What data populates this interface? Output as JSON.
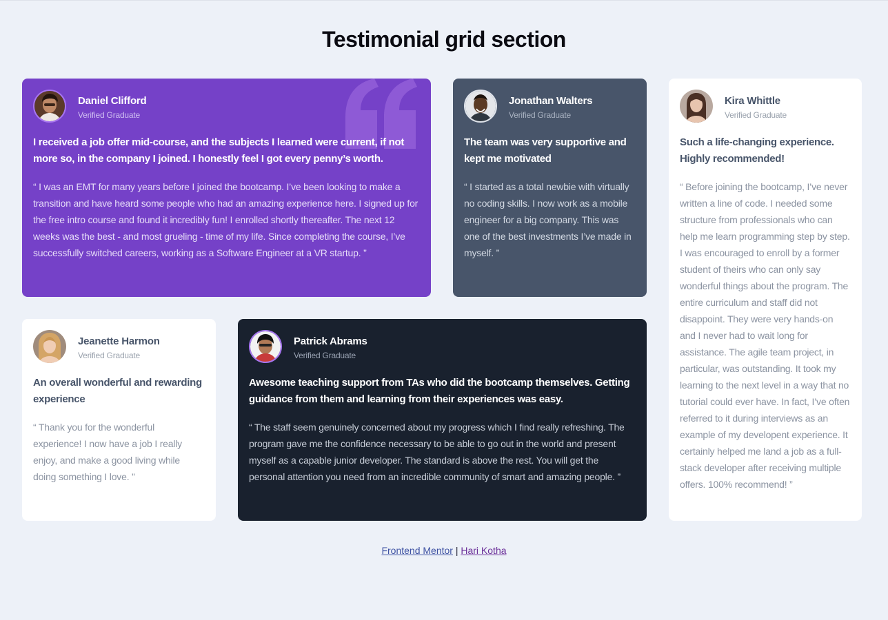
{
  "title": "Testimonial grid section",
  "cards": [
    {
      "name": "Daniel Clifford",
      "role": "Verified Graduate",
      "headline": "I received a job offer mid-course, and the subjects I learned were current, if not more so, in the company I joined. I honestly feel I got every penny’s worth.",
      "quote": "“ I was an EMT for many years before I joined the bootcamp. I’ve been looking to make a transition and have heard some people who had an amazing experience here. I signed up for the free intro course and found it incredibly fun! I enrolled shortly thereafter. The next 12 weeks was the best - and most grueling - time of my life. Since completing the course, I’ve successfully switched careers, working as a Software Engineer at a VR startup. ”"
    },
    {
      "name": "Jonathan Walters",
      "role": "Verified Graduate",
      "headline": "The team was very supportive and kept me motivated",
      "quote": "“ I started as a total newbie with virtually no coding skills. I now work as a mobile engineer for a big company. This was one of the best investments I’ve made in myself. ”"
    },
    {
      "name": "Kira Whittle",
      "role": "Verified Graduate",
      "headline": "Such a life-changing experience. Highly recommended!",
      "quote": "“ Before joining the bootcamp, I’ve never written a line of code. I needed some structure from professionals who can help me learn programming step by step. I was encouraged to enroll by a former student of theirs who can only say wonderful things about the program. The entire curriculum and staff did not disappoint. They were very hands-on and I never had to wait long for assistance. The agile team project, in particular, was outstanding. It took my learning to the next level in a way that no tutorial could ever have. In fact, I’ve often referred to it during interviews as an example of my developent experience. It certainly helped me land a job as a full-stack developer after receiving multiple offers. 100% recommend! ”"
    },
    {
      "name": "Jeanette Harmon",
      "role": "Verified Graduate",
      "headline": "An overall wonderful and rewarding experience",
      "quote": "“ Thank you for the wonderful experience! I now have a job I really enjoy, and make a good living while doing something I love. ”"
    },
    {
      "name": "Patrick Abrams",
      "role": "Verified Graduate",
      "headline": "Awesome teaching support from TAs who did the bootcamp themselves. Getting guidance from them and learning from their experiences was easy.",
      "quote": "“ The staff seem genuinely concerned about my progress which I find really refreshing. The program gave me the confidence necessary to be able to go out in the world and present myself as a capable junior developer. The standard is above the rest. You will get the personal attention you need from an incredible community of smart and amazing people. ”"
    }
  ],
  "attribution": {
    "link1": "Frontend Mentor",
    "separator": "|",
    "link2": "Hari Kotha"
  },
  "colors": {
    "purple": "#7541c8",
    "slate": "#48556a",
    "dark": "#19212e",
    "white": "#ffffff",
    "background": "#edf1f8"
  },
  "icons": [
    "quotation-mark-icon"
  ]
}
